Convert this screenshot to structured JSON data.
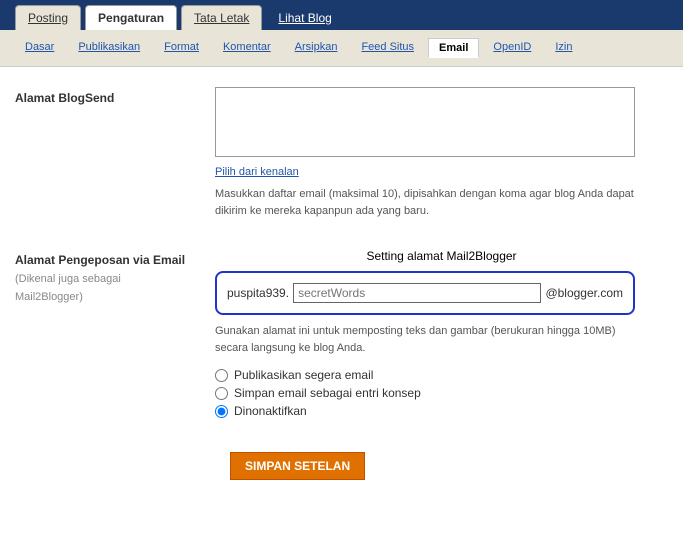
{
  "maintabs": {
    "posting": "Posting",
    "pengaturan": "Pengaturan",
    "tataletak": "Tata Letak",
    "lihatblog": "Lihat Blog"
  },
  "subtabs": {
    "dasar": "Dasar",
    "publikasikan": "Publikasikan",
    "format": "Format",
    "komentar": "Komentar",
    "arsipkan": "Arsipkan",
    "feedsitus": "Feed Situs",
    "email": "Email",
    "openid": "OpenID",
    "izin": "Izin"
  },
  "blogsend": {
    "label": "Alamat BlogSend",
    "pick_link": "Pilih dari kenalan",
    "help": "Masukkan daftar email (maksimal 10), dipisahkan dengan koma agar blog Anda dapat dikirim ke mereka kapanpun ada yang baru."
  },
  "mail2blogger": {
    "callout": "Setting alamat Mail2Blogger",
    "label": "Alamat Pengeposan via Email",
    "sublabel1": "(Dikenal juga sebagai",
    "sublabel2": "Mail2Blogger)",
    "prefix": "puspita939.",
    "placeholder": "secretWords",
    "suffix": "@blogger.com",
    "help": "Gunakan alamat ini untuk memposting teks dan gambar (berukuran hingga 10MB) secara langsung ke blog Anda.",
    "opt_publish": "Publikasikan segera email",
    "opt_draft": "Simpan email sebagai entri konsep",
    "opt_disabled": "Dinonaktifkan"
  },
  "save_button": "SIMPAN SETELAN"
}
